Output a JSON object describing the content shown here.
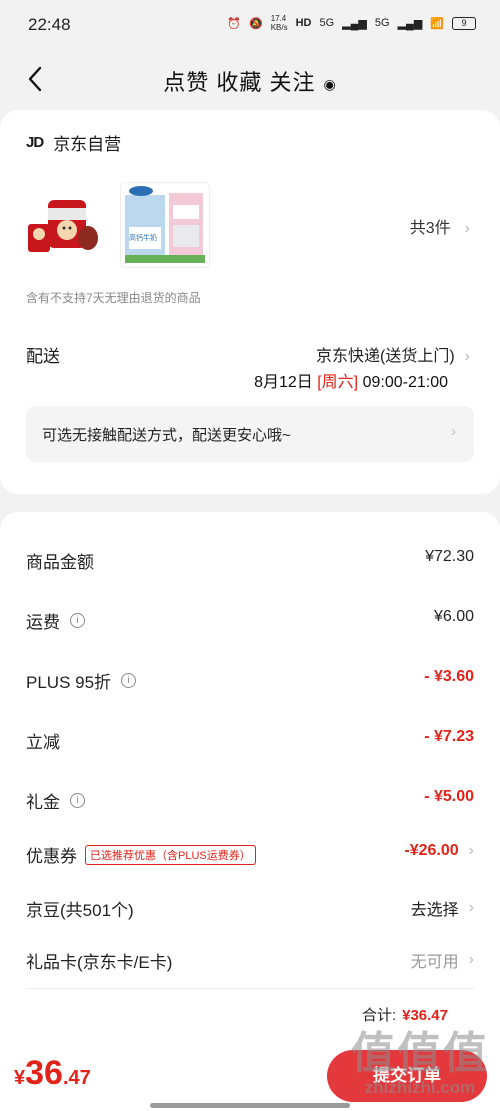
{
  "status": {
    "time": "22:48",
    "net_speed": "17.4\nKB/s",
    "hd": "HD",
    "sig1": "5G",
    "sig2": "5G",
    "battery": "9"
  },
  "nav": {
    "title": "点赞 收藏 关注"
  },
  "shop": {
    "logo": "JD",
    "name": "京东自营"
  },
  "items": {
    "count": "共3件",
    "notice": "含有不支持7天无理由退货的商品",
    "thumb_label": "高钙牛奶"
  },
  "shipping": {
    "label": "配送",
    "method": "京东快递(送货上门)",
    "date": "8月12日",
    "weekday": "[周六]",
    "time_range": "09:00-21:00",
    "tip": "可选无接触配送方式，配送更安心哦~"
  },
  "summary": {
    "goods_label": "商品金额",
    "goods_value": "¥72.30",
    "freight_label": "运费",
    "freight_value": "¥6.00",
    "plus_label": "PLUS 95折",
    "plus_value": "- ¥3.60",
    "cut_label": "立减",
    "cut_value": "- ¥7.23",
    "gift_label": "礼金",
    "gift_value": "- ¥5.00",
    "coupon_label": "优惠券",
    "coupon_tag": "已选推荐优惠（含PLUS运费券）",
    "coupon_value": "-¥26.00",
    "beans_label": "京豆(共501个)",
    "beans_value": "去选择",
    "card_label": "礼品卡(京东卡/E卡)",
    "card_value": "无可用",
    "total_label": "合计:",
    "total_value": "¥36.47"
  },
  "bottom": {
    "currency": "¥",
    "price_int": "36",
    "price_dec": ".47",
    "submit_label": "提交订单"
  },
  "watermark": {
    "text": "值值值",
    "url": "zhizhizhi.com"
  },
  "colors": {
    "accent": "#e2231a",
    "button": "#e4393c"
  }
}
